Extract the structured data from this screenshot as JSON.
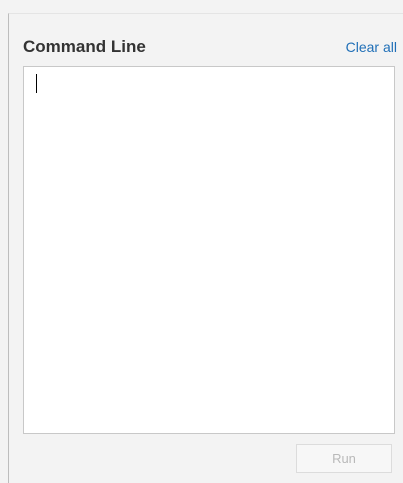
{
  "panel": {
    "title": "Command Line",
    "clear_all_label": "Clear all"
  },
  "command_input": {
    "value": "",
    "state": "focused"
  },
  "run_button": {
    "label": "Run",
    "state": "disabled"
  }
}
